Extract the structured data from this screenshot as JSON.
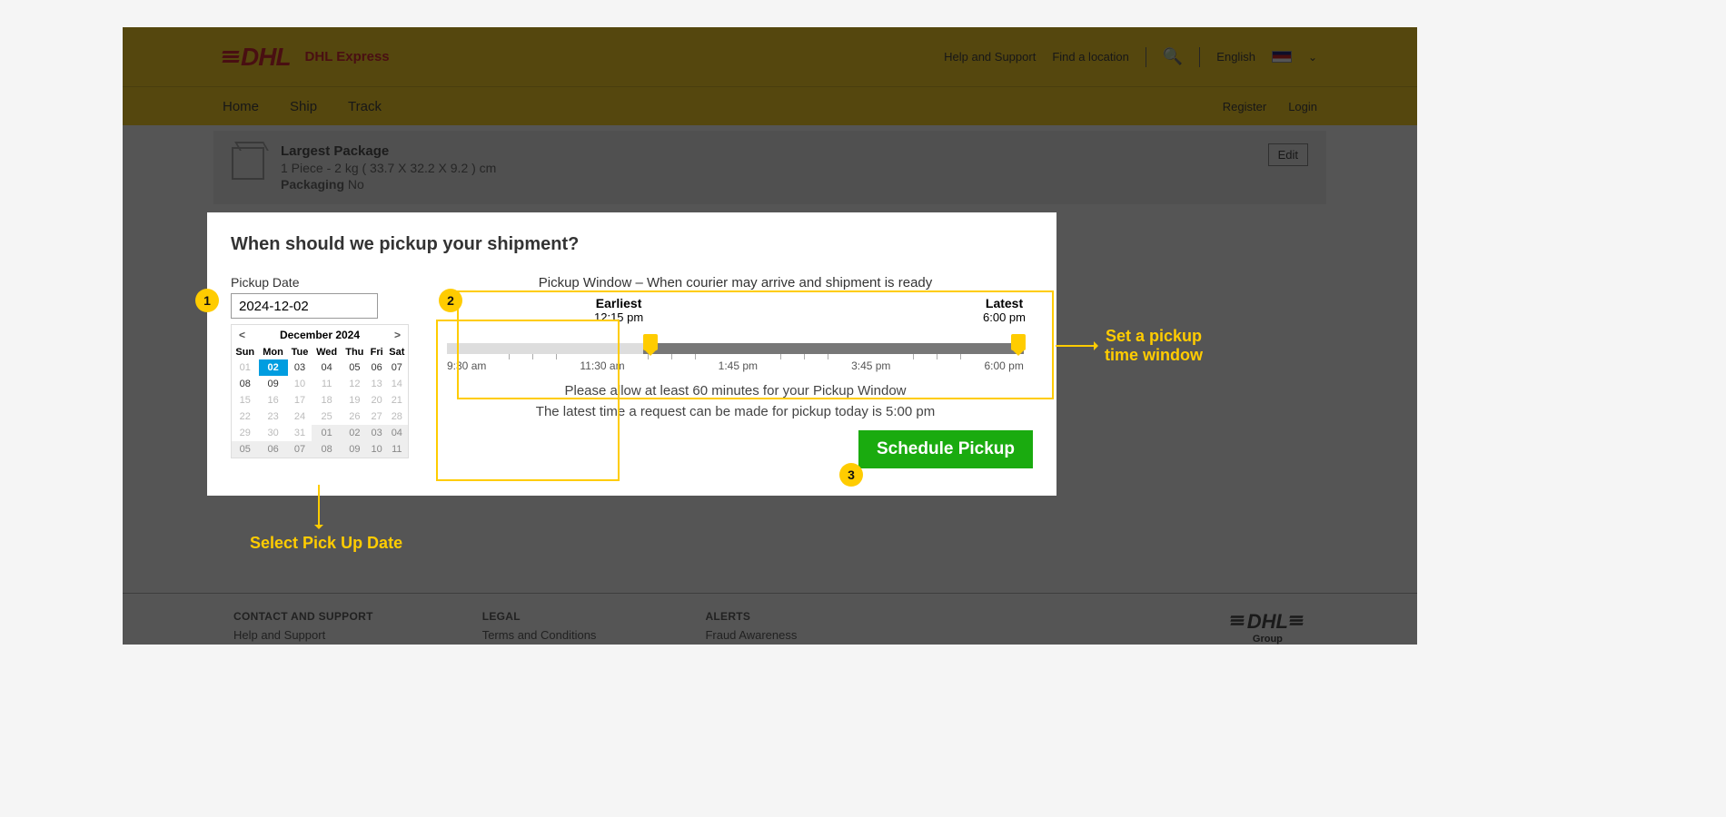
{
  "header": {
    "brand": "DHL Express",
    "logo_text": "DHL",
    "help": "Help and Support",
    "find": "Find a location",
    "language": "English",
    "nav": {
      "home": "Home",
      "ship": "Ship",
      "track": "Track",
      "register": "Register",
      "login": "Login"
    }
  },
  "summary": {
    "title": "Largest Package",
    "line1": "1 Piece - 2 kg ( 33.7 X 32.2 X 9.2 ) cm",
    "pack_label": "Packaging",
    "pack_val": "No",
    "edit": "Edit"
  },
  "modal": {
    "title": "When should we pickup your shipment?",
    "pickup_date_label": "Pickup Date",
    "pickup_date_value": "2024-12-02",
    "calendar": {
      "prev": "<",
      "next": ">",
      "title": "December 2024",
      "dow": [
        "Sun",
        "Mon",
        "Tue",
        "Wed",
        "Thu",
        "Fri",
        "Sat"
      ],
      "rows": [
        [
          {
            "d": "01",
            "off": true
          },
          {
            "d": "02",
            "sel": true
          },
          {
            "d": "03"
          },
          {
            "d": "04"
          },
          {
            "d": "05"
          },
          {
            "d": "06"
          },
          {
            "d": "07"
          }
        ],
        [
          {
            "d": "08"
          },
          {
            "d": "09"
          },
          {
            "d": "10",
            "off": true
          },
          {
            "d": "11",
            "off": true
          },
          {
            "d": "12",
            "off": true
          },
          {
            "d": "13",
            "off": true
          },
          {
            "d": "14",
            "off": true
          }
        ],
        [
          {
            "d": "15",
            "off": true
          },
          {
            "d": "16",
            "off": true
          },
          {
            "d": "17",
            "off": true
          },
          {
            "d": "18",
            "off": true
          },
          {
            "d": "19",
            "off": true
          },
          {
            "d": "20",
            "off": true
          },
          {
            "d": "21",
            "off": true
          }
        ],
        [
          {
            "d": "22",
            "off": true
          },
          {
            "d": "23",
            "off": true
          },
          {
            "d": "24",
            "off": true
          },
          {
            "d": "25",
            "off": true
          },
          {
            "d": "26",
            "off": true
          },
          {
            "d": "27",
            "off": true
          },
          {
            "d": "28",
            "off": true
          }
        ],
        [
          {
            "d": "29",
            "off": true
          },
          {
            "d": "30",
            "off": true
          },
          {
            "d": "31",
            "off": true
          },
          {
            "d": "01",
            "g": true
          },
          {
            "d": "02",
            "g": true
          },
          {
            "d": "03",
            "g": true
          },
          {
            "d": "04",
            "g": true
          }
        ],
        [
          {
            "d": "05",
            "g": true
          },
          {
            "d": "06",
            "g": true
          },
          {
            "d": "07",
            "g": true
          },
          {
            "d": "08",
            "g": true
          },
          {
            "d": "09",
            "g": true
          },
          {
            "d": "10",
            "g": true
          },
          {
            "d": "11",
            "g": true
          }
        ]
      ]
    },
    "pw_label": "Pickup Window – When courier may arrive and shipment is ready",
    "earliest_label": "Earliest",
    "earliest_time": "12:15 pm",
    "latest_label": "Latest",
    "latest_time": "6:00 pm",
    "tick_labels": [
      "9:30 am",
      "11:30 am",
      "1:45 pm",
      "3:45 pm",
      "6:00 pm"
    ],
    "hint1": "Please allow at least 60 minutes for your Pickup Window",
    "hint2": "The latest time a request can be made for pickup today is 5:00 pm",
    "schedule": "Schedule Pickup"
  },
  "annotations": {
    "m1": "1",
    "m2": "2",
    "m3": "3",
    "select_date": "Select Pick Up Date",
    "set_window_l1": "Set a pickup",
    "set_window_l2": "time window"
  },
  "footer": {
    "c1_h": "CONTACT AND SUPPORT",
    "c1_a": "Help and Support",
    "c2_h": "LEGAL",
    "c2_a": "Terms and Conditions",
    "c3_h": "ALERTS",
    "c3_a": "Fraud Awareness",
    "group": "Group"
  }
}
